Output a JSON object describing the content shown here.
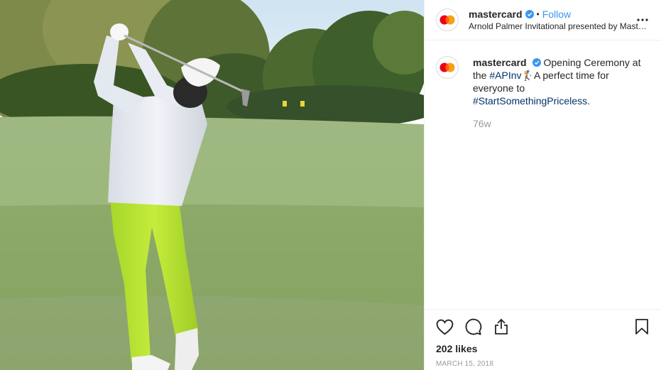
{
  "post": {
    "header": {
      "username": "mastercard",
      "separator": "•",
      "follow_label": "Follow",
      "location": "Arnold Palmer Invitational presented by Maste..."
    },
    "caption": {
      "username": "mastercard",
      "text_before": "Opening Ceremony at the ",
      "hashtag_1": "#APInv",
      "emoji": "🏌",
      "text_middle": "A perfect time for everyone to ",
      "hashtag_2": "#StartSomethingPriceless",
      "text_end": "."
    },
    "time_ago": "76w",
    "likes": "202 likes",
    "date": "March 15, 2018"
  },
  "colors": {
    "link_blue": "#3897f0",
    "hashtag_navy": "#003569",
    "verified_blue": "#3897f0",
    "mastercard_red": "#eb001b",
    "mastercard_orange": "#f79e1b"
  },
  "icons": [
    "mastercard-logo-icon",
    "verified-badge-icon",
    "more-options-icon",
    "heart-icon",
    "comment-icon",
    "share-icon",
    "bookmark-icon"
  ]
}
